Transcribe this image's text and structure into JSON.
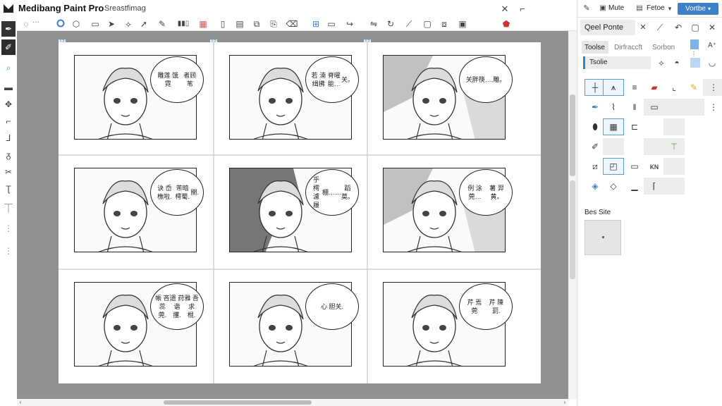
{
  "app": {
    "title": "Medibang Paint Pro",
    "subtitle": "Sreastfimag"
  },
  "window": {
    "close_glyph": "✕",
    "pin_glyph": "⌐"
  },
  "toolbar": {
    "zoom_dots": "···"
  },
  "canvas": {
    "grid_markers": [
      "12",
      "12",
      "12"
    ]
  },
  "panels": [
    {
      "lines": [
        "雕莲 饿霓",
        "者顾苇"
      ],
      "shade": "none"
    },
    {
      "lines": [
        "若 湳 缉拂",
        "脊曜能…",
        "关。"
      ],
      "shade": "none"
    },
    {
      "lines": [
        "关胖筷….",
        "雕。"
      ],
      "shade": "dark"
    },
    {
      "lines": [
        "诀 岙 樵啦.",
        "芾暗樗蜀.",
        "關."
      ],
      "shade": "none"
    },
    {
      "lines": [
        "乎 樗 濾履",
        "棚……",
        "蹈莫。"
      ],
      "shade": "hair"
    },
    {
      "lines": [
        "例 涂 莞…",
        "薯 羿 黄。"
      ],
      "shade": "dark"
    },
    {
      "lines": [
        "帳 吝 蕊 莞.",
        "遗 荮 谐 攫.",
        "雅 吾 求 棍."
      ],
      "shade": "none"
    },
    {
      "lines": [
        "心 胆",
        "关."
      ],
      "shade": "none"
    },
    {
      "lines": [
        "芹 焉 莞",
        "芹 陳 罰."
      ],
      "shade": "none"
    }
  ],
  "right": {
    "top_buttons": {
      "mute": "Mute",
      "fetch": "Fetoe",
      "view": "Vortbe"
    },
    "panel_title": "Qeel Ponte",
    "tabs": [
      "Toolse",
      "Dirfraccft",
      "Sorbon"
    ],
    "field_value": "Tsolie",
    "section_label": "Bes Site",
    "colors": {
      "accent": "#3d7fc9",
      "selected_border": "#5a9bd8"
    }
  }
}
